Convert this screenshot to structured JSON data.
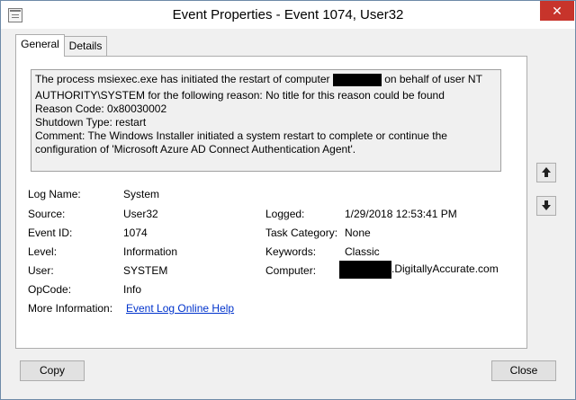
{
  "window": {
    "title": "Event Properties - Event 1074, User32",
    "close_glyph": "✕"
  },
  "tabs": [
    {
      "label": "General",
      "active": true
    },
    {
      "label": "Details",
      "active": false
    }
  ],
  "description": {
    "line1_before": "The process msiexec.exe has initiated the restart of computer",
    "line1_after": "on behalf of user NT",
    "line2": "AUTHORITY\\SYSTEM for the following reason: No title for this reason could be found",
    "line3": " Reason Code: 0x80030002",
    "line4": " Shutdown Type: restart",
    "line5": " Comment: The Windows Installer initiated a system restart to complete or continue the",
    "line6": "configuration of 'Microsoft Azure AD Connect Authentication Agent'."
  },
  "fields": {
    "log_name": {
      "label": "Log Name:",
      "value": "System"
    },
    "source": {
      "label": "Source:",
      "value": "User32"
    },
    "event_id": {
      "label": "Event ID:",
      "value": "1074"
    },
    "level": {
      "label": "Level:",
      "value": "Information"
    },
    "user": {
      "label": "User:",
      "value": "SYSTEM"
    },
    "opcode": {
      "label": "OpCode:",
      "value": "Info"
    },
    "more_info": {
      "label": "More Information:",
      "value": "Event Log Online Help"
    },
    "logged": {
      "label": "Logged:",
      "value": "1/29/2018 12:53:41 PM"
    },
    "task_category": {
      "label": "Task Category:",
      "value": "None"
    },
    "keywords": {
      "label": "Keywords:",
      "value": "Classic"
    },
    "computer": {
      "label": "Computer:",
      "value_suffix": ".DigitallyAccurate.com"
    }
  },
  "buttons": {
    "copy": "Copy",
    "close": "Close"
  },
  "icons": {
    "up": "arrow-up-icon",
    "down": "arrow-down-icon",
    "app": "event-viewer-icon"
  },
  "colors": {
    "close_button": "#c7342b",
    "link": "#0033cc",
    "dialog_bg": "#f0f0f0"
  }
}
